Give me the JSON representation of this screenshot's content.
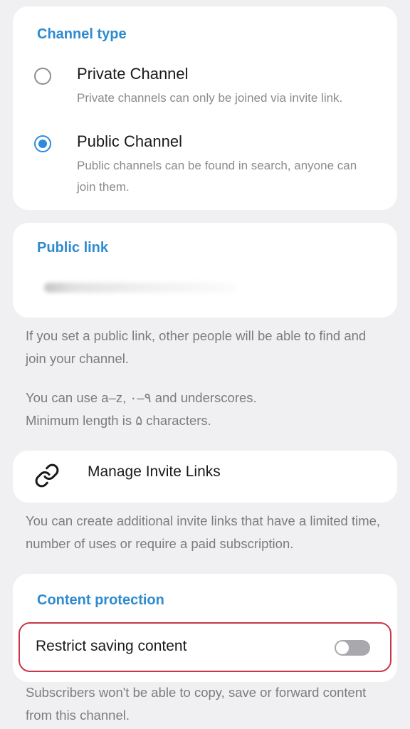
{
  "channel_type": {
    "title": "Channel type",
    "options": [
      {
        "title": "Private Channel",
        "description": "Private channels can only be joined via invite link.",
        "selected": false
      },
      {
        "title": "Public Channel",
        "description": "Public channels can be found in search, anyone can join them.",
        "selected": true
      }
    ]
  },
  "public_link": {
    "title": "Public link",
    "value_redacted": true
  },
  "hints": {
    "public_link_info": "If you set a public link, other people will be able to find and join your channel.",
    "allowed_chars": "You can use a–z, ۰–۹ and underscores.",
    "min_length": "Minimum length is ۵ characters.",
    "invite_links_info": "You can create additional invite links that have a limited time, number of uses or require a paid subscription.",
    "protection_info": "Subscribers won't be able to copy, save or forward content from this channel."
  },
  "manage_invite_links": {
    "label": "Manage Invite Links",
    "icon": "link-icon"
  },
  "content_protection": {
    "title": "Content protection",
    "restrict_label": "Restrict saving content",
    "restrict_enabled": false,
    "highlight_color": "#c8374a"
  },
  "colors": {
    "accent": "#2e8bdc",
    "background": "#f0f0f2"
  }
}
